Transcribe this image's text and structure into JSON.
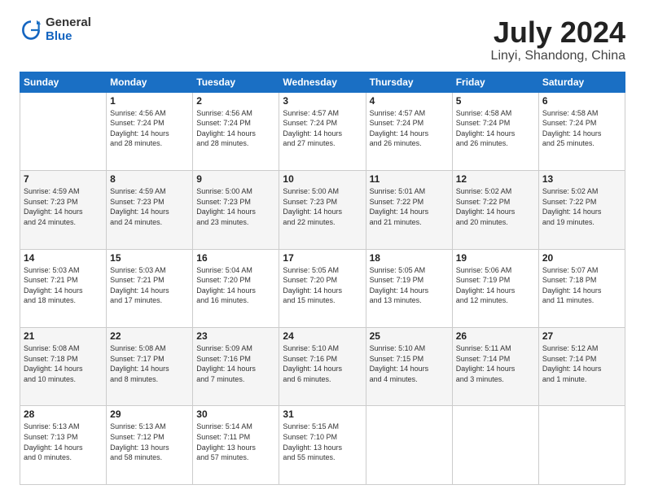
{
  "logo": {
    "general": "General",
    "blue": "Blue"
  },
  "title": "July 2024",
  "subtitle": "Linyi, Shandong, China",
  "days_of_week": [
    "Sunday",
    "Monday",
    "Tuesday",
    "Wednesday",
    "Thursday",
    "Friday",
    "Saturday"
  ],
  "weeks": [
    [
      {
        "day": "",
        "info": ""
      },
      {
        "day": "1",
        "info": "Sunrise: 4:56 AM\nSunset: 7:24 PM\nDaylight: 14 hours\nand 28 minutes."
      },
      {
        "day": "2",
        "info": "Sunrise: 4:56 AM\nSunset: 7:24 PM\nDaylight: 14 hours\nand 28 minutes."
      },
      {
        "day": "3",
        "info": "Sunrise: 4:57 AM\nSunset: 7:24 PM\nDaylight: 14 hours\nand 27 minutes."
      },
      {
        "day": "4",
        "info": "Sunrise: 4:57 AM\nSunset: 7:24 PM\nDaylight: 14 hours\nand 26 minutes."
      },
      {
        "day": "5",
        "info": "Sunrise: 4:58 AM\nSunset: 7:24 PM\nDaylight: 14 hours\nand 26 minutes."
      },
      {
        "day": "6",
        "info": "Sunrise: 4:58 AM\nSunset: 7:24 PM\nDaylight: 14 hours\nand 25 minutes."
      }
    ],
    [
      {
        "day": "7",
        "info": "Sunrise: 4:59 AM\nSunset: 7:23 PM\nDaylight: 14 hours\nand 24 minutes."
      },
      {
        "day": "8",
        "info": "Sunrise: 4:59 AM\nSunset: 7:23 PM\nDaylight: 14 hours\nand 24 minutes."
      },
      {
        "day": "9",
        "info": "Sunrise: 5:00 AM\nSunset: 7:23 PM\nDaylight: 14 hours\nand 23 minutes."
      },
      {
        "day": "10",
        "info": "Sunrise: 5:00 AM\nSunset: 7:23 PM\nDaylight: 14 hours\nand 22 minutes."
      },
      {
        "day": "11",
        "info": "Sunrise: 5:01 AM\nSunset: 7:22 PM\nDaylight: 14 hours\nand 21 minutes."
      },
      {
        "day": "12",
        "info": "Sunrise: 5:02 AM\nSunset: 7:22 PM\nDaylight: 14 hours\nand 20 minutes."
      },
      {
        "day": "13",
        "info": "Sunrise: 5:02 AM\nSunset: 7:22 PM\nDaylight: 14 hours\nand 19 minutes."
      }
    ],
    [
      {
        "day": "14",
        "info": "Sunrise: 5:03 AM\nSunset: 7:21 PM\nDaylight: 14 hours\nand 18 minutes."
      },
      {
        "day": "15",
        "info": "Sunrise: 5:03 AM\nSunset: 7:21 PM\nDaylight: 14 hours\nand 17 minutes."
      },
      {
        "day": "16",
        "info": "Sunrise: 5:04 AM\nSunset: 7:20 PM\nDaylight: 14 hours\nand 16 minutes."
      },
      {
        "day": "17",
        "info": "Sunrise: 5:05 AM\nSunset: 7:20 PM\nDaylight: 14 hours\nand 15 minutes."
      },
      {
        "day": "18",
        "info": "Sunrise: 5:05 AM\nSunset: 7:19 PM\nDaylight: 14 hours\nand 13 minutes."
      },
      {
        "day": "19",
        "info": "Sunrise: 5:06 AM\nSunset: 7:19 PM\nDaylight: 14 hours\nand 12 minutes."
      },
      {
        "day": "20",
        "info": "Sunrise: 5:07 AM\nSunset: 7:18 PM\nDaylight: 14 hours\nand 11 minutes."
      }
    ],
    [
      {
        "day": "21",
        "info": "Sunrise: 5:08 AM\nSunset: 7:18 PM\nDaylight: 14 hours\nand 10 minutes."
      },
      {
        "day": "22",
        "info": "Sunrise: 5:08 AM\nSunset: 7:17 PM\nDaylight: 14 hours\nand 8 minutes."
      },
      {
        "day": "23",
        "info": "Sunrise: 5:09 AM\nSunset: 7:16 PM\nDaylight: 14 hours\nand 7 minutes."
      },
      {
        "day": "24",
        "info": "Sunrise: 5:10 AM\nSunset: 7:16 PM\nDaylight: 14 hours\nand 6 minutes."
      },
      {
        "day": "25",
        "info": "Sunrise: 5:10 AM\nSunset: 7:15 PM\nDaylight: 14 hours\nand 4 minutes."
      },
      {
        "day": "26",
        "info": "Sunrise: 5:11 AM\nSunset: 7:14 PM\nDaylight: 14 hours\nand 3 minutes."
      },
      {
        "day": "27",
        "info": "Sunrise: 5:12 AM\nSunset: 7:14 PM\nDaylight: 14 hours\nand 1 minute."
      }
    ],
    [
      {
        "day": "28",
        "info": "Sunrise: 5:13 AM\nSunset: 7:13 PM\nDaylight: 14 hours\nand 0 minutes."
      },
      {
        "day": "29",
        "info": "Sunrise: 5:13 AM\nSunset: 7:12 PM\nDaylight: 13 hours\nand 58 minutes."
      },
      {
        "day": "30",
        "info": "Sunrise: 5:14 AM\nSunset: 7:11 PM\nDaylight: 13 hours\nand 57 minutes."
      },
      {
        "day": "31",
        "info": "Sunrise: 5:15 AM\nSunset: 7:10 PM\nDaylight: 13 hours\nand 55 minutes."
      },
      {
        "day": "",
        "info": ""
      },
      {
        "day": "",
        "info": ""
      },
      {
        "day": "",
        "info": ""
      }
    ]
  ]
}
